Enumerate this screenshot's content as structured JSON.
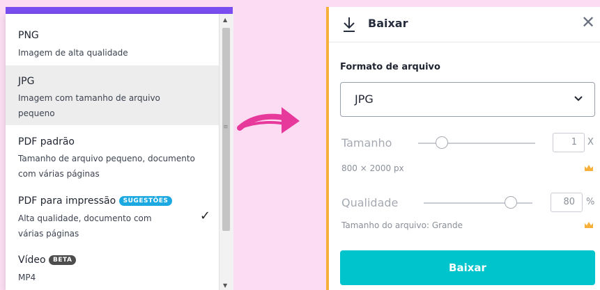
{
  "dropdown": {
    "options": [
      {
        "title": "PNG",
        "desc": "Imagem de alta qualidade"
      },
      {
        "title": "JPG",
        "desc": "Imagem com tamanho de arquivo pequeno"
      },
      {
        "title": "PDF padrão",
        "desc": "Tamanho de arquivo pequeno, documento com várias páginas"
      },
      {
        "title": "PDF para impressão",
        "badge": "SUGESTÕES",
        "desc": "Alta qualidade, documento com várias páginas"
      },
      {
        "title": "Vídeo",
        "badge": "BETA",
        "desc": "MP4"
      }
    ],
    "check": "✓",
    "selected": "JPG"
  },
  "panel": {
    "title": "Baixar",
    "close": "✕",
    "format_label": "Formato de arquivo",
    "format_value": "JPG",
    "size_label": "Tamanho",
    "size_value": "1",
    "size_unit": "X",
    "size_slider": 0.2,
    "dimensions": "800 × 2000 px",
    "quality_label": "Qualidade",
    "quality_value": "80",
    "quality_unit": "%",
    "quality_slider": 0.8,
    "file_size": "Tamanho do arquivo: Grande",
    "button": "Baixar"
  },
  "colors": {
    "accent": "#00c4cc",
    "purple": "#7a4df0",
    "badge_blue": "#1ca8e0",
    "arrow": "#e6399b",
    "crown": "#f7b13b"
  }
}
